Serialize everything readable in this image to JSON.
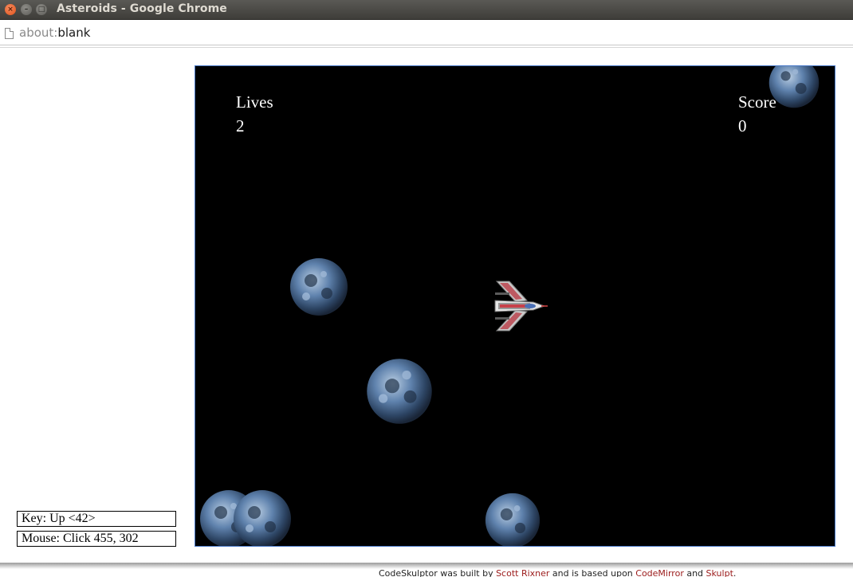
{
  "window": {
    "title": "Asteroids - Google Chrome",
    "controls": {
      "close": "×",
      "minimize": "–",
      "maximize": "□"
    }
  },
  "address_bar": {
    "scheme": "about:",
    "path": "blank"
  },
  "game": {
    "lives_label": "Lives",
    "lives_value": "2",
    "score_label": "Score",
    "score_value": "0"
  },
  "status": {
    "key": "Key: Up <42>",
    "mouse": "Mouse: Click 455, 302"
  },
  "footer": {
    "prefix": "CodeSkulptor was built by ",
    "author": "Scott Rixner",
    "middle": " and is based upon ",
    "link1": "CodeMirror",
    "and": " and ",
    "link2": "Skulpt",
    "suffix": "."
  },
  "colors": {
    "canvas_bg": "#000000",
    "canvas_border": "#4a7ac8",
    "link": "#9b1a1a",
    "asteroid": "#6f8fb5"
  }
}
